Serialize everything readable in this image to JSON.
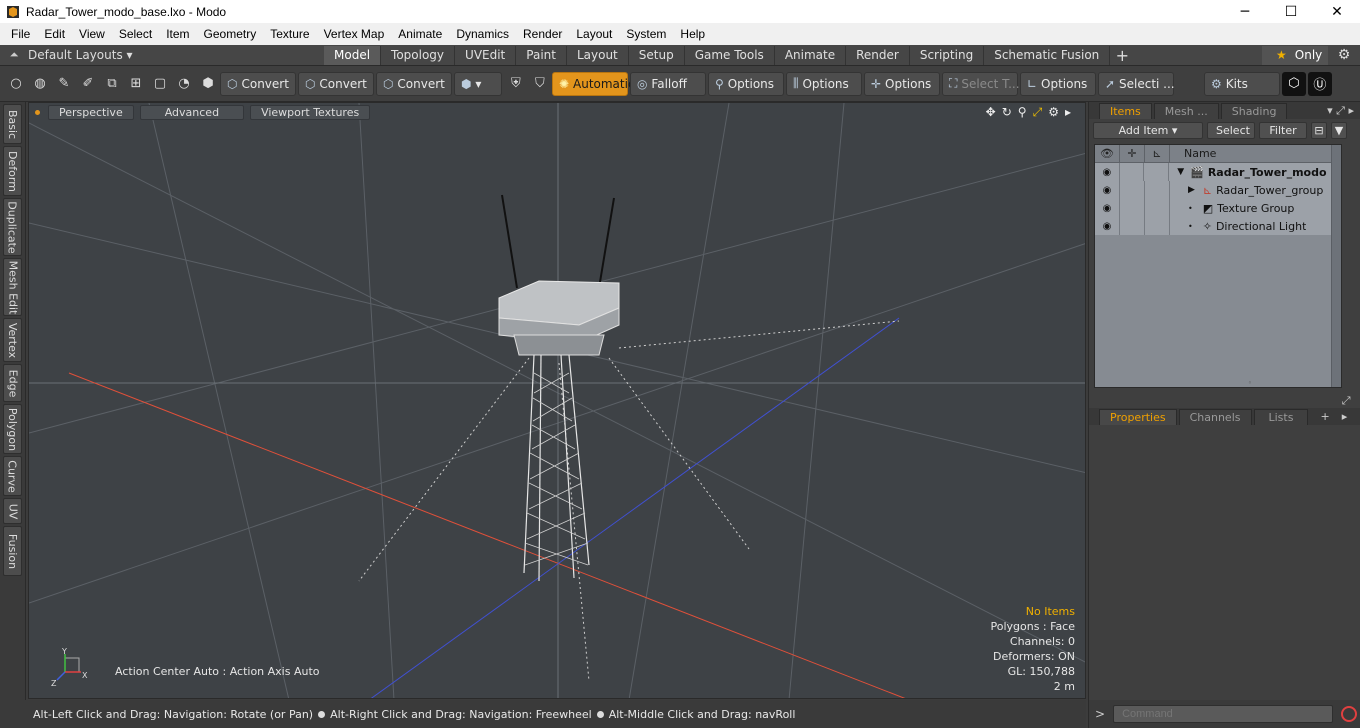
{
  "window": {
    "title": "Radar_Tower_modo_base.lxo - Modo",
    "minimize": "─",
    "maximize": "☐",
    "close": "✕"
  },
  "menu": [
    "File",
    "Edit",
    "View",
    "Select",
    "Item",
    "Geometry",
    "Texture",
    "Vertex Map",
    "Animate",
    "Dynamics",
    "Render",
    "Layout",
    "System",
    "Help"
  ],
  "layoutbar": {
    "layouts_label": "Default Layouts ▾",
    "tabs": [
      "Model",
      "Topology",
      "UVEdit",
      "Paint",
      "Layout",
      "Setup",
      "Game Tools",
      "Animate",
      "Render",
      "Scripting",
      "Schematic Fusion"
    ],
    "active_tab": "Model",
    "add": "+",
    "only_label": "Only"
  },
  "toolbar": {
    "convert1": "Convert",
    "convert2": "Convert",
    "convert3": "Convert",
    "automatic": "Automatic",
    "falloff": "Falloff",
    "options1": "Options",
    "options2": "Options",
    "options3": "Options",
    "select_t": "Select T...",
    "options4": "Options",
    "selecti": "Selecti ...",
    "kits": "Kits"
  },
  "lefttabs": [
    "Basic",
    "Deform",
    "Duplicate",
    "Mesh Edit",
    "Vertex",
    "Edge",
    "Polygon",
    "Curve",
    "UV",
    "Fusion"
  ],
  "viewport": {
    "perspective": "Perspective",
    "advanced": "Advanced",
    "textures": "Viewport Textures",
    "action_center": "Action Center Auto : Action Axis Auto",
    "stats": {
      "no_items": "No Items",
      "polygons": "Polygons : Face",
      "channels": "Channels: 0",
      "deformers": "Deformers: ON",
      "gl": "GL: 150,788",
      "scale": "2 m"
    },
    "axis": {
      "y": "Y",
      "x": "X",
      "z": "Z"
    }
  },
  "statusbar": {
    "hint1": "Alt-Left Click and Drag: Navigation: Rotate (or Pan)",
    "hint2": "Alt-Right Click and Drag: Navigation: Freewheel",
    "hint3": "Alt-Middle Click and Drag: navRoll"
  },
  "items_panel": {
    "tabs": [
      "Items",
      "Mesh ...",
      "Shading"
    ],
    "add_item": "Add Item",
    "select": "Select",
    "filter": "Filter",
    "name_header": "Name",
    "rows": [
      {
        "label": "Radar_Tower_modo ...",
        "bold": true
      },
      {
        "label": "Radar_Tower_group",
        "bold": false
      },
      {
        "label": "Texture Group",
        "bold": false
      },
      {
        "label": "Directional Light",
        "bold": false
      }
    ]
  },
  "props_panel": {
    "tabs": [
      "Properties",
      "Channels",
      "Lists"
    ],
    "add": "+"
  },
  "command": {
    "prompt": ">",
    "placeholder": "Command"
  },
  "colors": {
    "accent": "#e3951c",
    "viewport_bg": "#3e4246",
    "x_axis": "#e0503a",
    "z_axis": "#4050d0"
  }
}
